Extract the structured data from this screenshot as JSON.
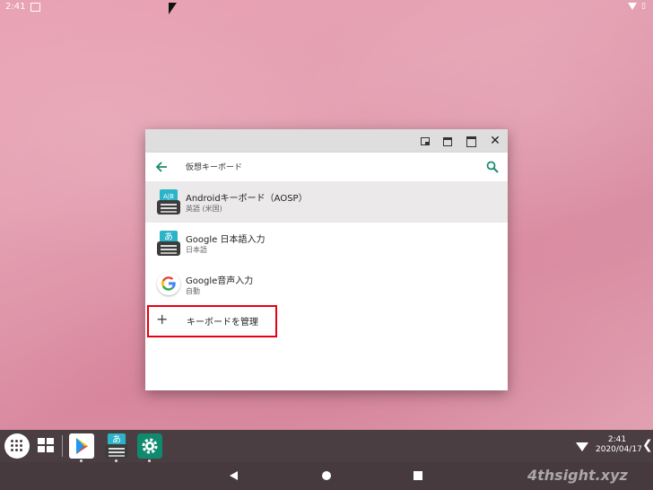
{
  "status_bar": {
    "time": "2:41"
  },
  "window": {
    "title": "仮想キーボード",
    "keyboards": [
      {
        "name": "Androidキーボード（AOSP）",
        "sub": "英語 (米国)",
        "icon_glyph": "A|B",
        "icon": "aosp-keyboard-icon"
      },
      {
        "name": "Google 日本語入力",
        "sub": "日本語",
        "icon_glyph": "あ",
        "icon": "google-japanese-input-icon"
      },
      {
        "name": "Google音声入力",
        "sub": "自動",
        "icon": "google-g-icon"
      }
    ],
    "manage": {
      "plus": "+",
      "label": "キーボードを管理"
    }
  },
  "taskbar": {
    "clock_time": "2:41",
    "clock_date": "2020/04/17",
    "chevron": "❮",
    "ime_glyph": "あ"
  },
  "watermark": "4thsight.xyz",
  "colors": {
    "accent": "#1a8a6e",
    "highlight": "#e60012",
    "taskbar": "#4b3e42"
  }
}
